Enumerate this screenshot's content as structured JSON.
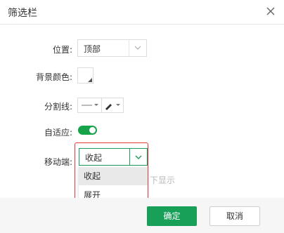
{
  "dialog": {
    "title": "筛选栏",
    "close_icon": "close-icon"
  },
  "form": {
    "position": {
      "label": "位置:",
      "value": "顶部"
    },
    "background_color": {
      "label": "背景颜色:"
    },
    "divider": {
      "label": "分割线:"
    },
    "adaptive": {
      "label": "自适应:",
      "enabled": true
    },
    "mobile": {
      "label": "移动端:",
      "value": "收起",
      "options": [
        "收起",
        "展开"
      ],
      "hovered_option": "收起",
      "partially_hidden_text": "下显示"
    }
  },
  "footer": {
    "ok_label": "确定",
    "cancel_label": "取消"
  },
  "colors": {
    "accent": "#18a058",
    "highlight_border": "#e53935",
    "toggle_on": "#16a34a"
  }
}
